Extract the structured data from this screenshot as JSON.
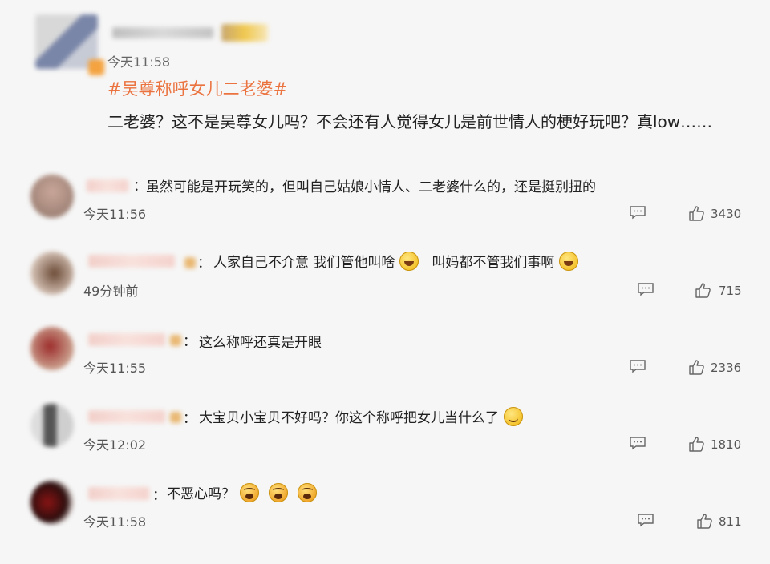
{
  "post": {
    "time": "今天11:58",
    "hashtag": "#吴尊称呼女儿二老婆#",
    "text": "二老婆？这不是吴尊女儿吗？不会还有人觉得女儿是前世情人的梗好玩吧？真low……"
  },
  "comments": [
    {
      "text": "虽然可能是开玩笑的，但叫自己姑娘小情人、二老婆什么的，还是挺别扭的",
      "time": "今天11:56",
      "likes": "3430"
    },
    {
      "text_parts": [
        "人家自己不介意 我们管他叫啥",
        "叫妈都不管我们事啊"
      ],
      "emojis": [
        "laugh-icon",
        "laugh-icon"
      ],
      "time": "49分钟前",
      "likes": "715"
    },
    {
      "text": "这么称呼还真是开眼",
      "time": "今天11:55",
      "likes": "2336"
    },
    {
      "text": "大宝贝小宝贝不好吗？你这个称呼把女儿当什么了",
      "emojis": [
        "smirk-icon"
      ],
      "time": "今天12:02",
      "likes": "1810"
    },
    {
      "text": "不恶心吗？",
      "emojis": [
        "angry-icon",
        "angry-icon",
        "angry-icon"
      ],
      "time": "今天11:58",
      "likes": "811"
    }
  ],
  "colors": {
    "hashtag": "#eb7340",
    "background": "#f6f6f6",
    "text": "#222222",
    "meta": "#555555"
  },
  "icons": {
    "reply": "comment-bubble-icon",
    "like": "thumbs-up-icon"
  }
}
